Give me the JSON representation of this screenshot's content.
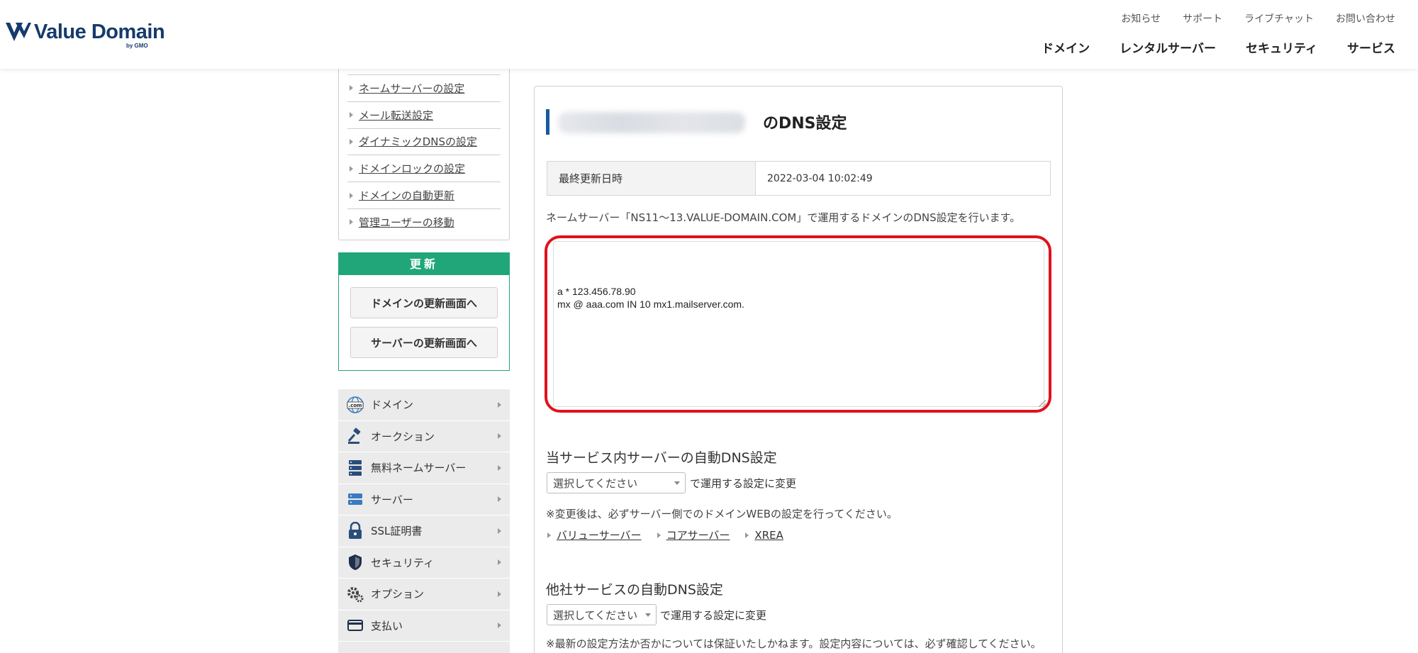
{
  "header": {
    "brand": "Value Domain",
    "brand_sub": "by GMO",
    "util_links": [
      "お知らせ",
      "サポート",
      "ライブチャット",
      "お問い合わせ"
    ],
    "main_links": [
      "ドメイン",
      "レンタルサーバー",
      "セキュリティ",
      "サービス"
    ]
  },
  "sidebar": {
    "links": [
      "ネームサーバーの設定",
      "メール転送設定",
      "ダイナミックDNSの設定",
      "ドメインロックの設定",
      "ドメインの自動更新",
      "管理ユーザーの移動"
    ],
    "renew": {
      "title": "更新",
      "domain_button": "ドメインの更新画面へ",
      "server_button": "サーバーの更新画面へ"
    },
    "menu": [
      {
        "label": "ドメイン",
        "icon": "globe-com-icon"
      },
      {
        "label": "オークション",
        "icon": "gavel-icon"
      },
      {
        "label": "無料ネームサーバー",
        "icon": "server-stack-icon"
      },
      {
        "label": "サーバー",
        "icon": "server-icon"
      },
      {
        "label": "SSL証明書",
        "icon": "lock-icon"
      },
      {
        "label": "セキュリティ",
        "icon": "shield-icon"
      },
      {
        "label": "オプション",
        "icon": "gear-icon"
      },
      {
        "label": "支払い",
        "icon": "card-icon"
      }
    ]
  },
  "main": {
    "title_suffix": "のDNS設定",
    "last_updated_label": "最終更新日時",
    "last_updated_value": "2022-03-04 10:02:49",
    "description": "ネームサーバー「NS11～13.VALUE-DOMAIN.COM」で運用するドメインのDNS設定を行います。",
    "dns_records": "a * 123.456.78.90\nmx @ aaa.com IN 10 mx1.mailserver.com.",
    "internal_section": {
      "title": "当サービス内サーバーの自動DNS設定",
      "select_value": "選択してください",
      "after_select": "で運用する設定に変更",
      "note": "※変更後は、必ずサーバー側でのドメインWEBの設定を行ってください。",
      "links": [
        "バリューサーバー",
        "コアサーバー",
        "XREA"
      ]
    },
    "external_section": {
      "title": "他社サービスの自動DNS設定",
      "select_value": "選択してください",
      "after_select": "で運用する設定に変更",
      "note": "※最新の設定方法か否かについては保証いたしかねます。設定内容については、必ず確認してください。"
    }
  },
  "colors": {
    "brand_navy": "#163a6b",
    "renew_green": "#21a67a",
    "highlight_red": "#e0121a",
    "title_accent": "#1a5aa0"
  }
}
